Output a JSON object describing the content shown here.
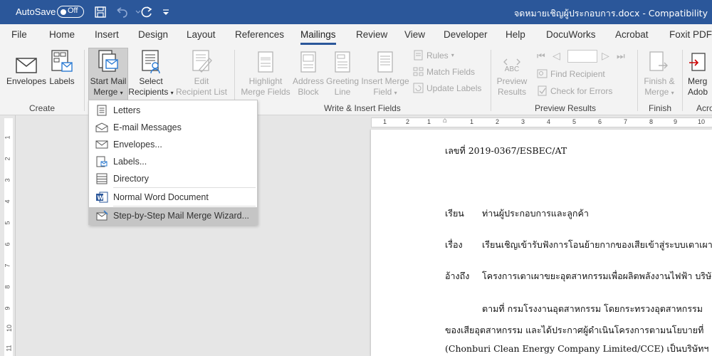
{
  "titlebar": {
    "autosave_label": "AutoSave",
    "autosave_state": "Off",
    "doc_title": "จดหมายเชิญผู้ประกอบการ.docx  -  Compatibility"
  },
  "tabs": [
    "File",
    "Home",
    "Insert",
    "Design",
    "Layout",
    "References",
    "Mailings",
    "Review",
    "View",
    "Developer",
    "Help",
    "DocuWorks",
    "Acrobat",
    "Foxit PDF"
  ],
  "active_tab": "Mailings",
  "ribbon": {
    "create": {
      "label": "Create",
      "envelopes": "Envelopes",
      "labels": "Labels"
    },
    "start": {
      "start_mail_merge_1": "Start Mail",
      "start_mail_merge_2": "Merge",
      "select_recipients_1": "Select",
      "select_recipients_2": "Recipients",
      "edit_list_1": "Edit",
      "edit_list_2": "Recipient List"
    },
    "write": {
      "label": "Write & Insert Fields",
      "highlight_1": "Highlight",
      "highlight_2": "Merge Fields",
      "address_1": "Address",
      "address_2": "Block",
      "greeting_1": "Greeting",
      "greeting_2": "Line",
      "insert_field_1": "Insert Merge",
      "insert_field_2": "Field",
      "rules": "Rules",
      "match_fields": "Match Fields",
      "update_labels": "Update Labels"
    },
    "preview": {
      "label": "Preview Results",
      "abc": "ABC",
      "preview_1": "Preview",
      "preview_2": "Results",
      "find_recipient": "Find Recipient",
      "check_errors": "Check for Errors"
    },
    "finish": {
      "label": "Finish",
      "finish_1": "Finish &",
      "finish_2": "Merge"
    },
    "acrobat": {
      "label": "Acro",
      "merge_1": "Merg",
      "merge_2": "Adob"
    }
  },
  "dropdown": [
    {
      "label": "Letters",
      "icon": "letter-icon"
    },
    {
      "label": "E-mail Messages",
      "icon": "email-icon"
    },
    {
      "label": "Envelopes...",
      "icon": "envelope-icon"
    },
    {
      "label": "Labels...",
      "icon": "labels-icon"
    },
    {
      "label": "Directory",
      "icon": "directory-icon"
    },
    {
      "label": "Normal Word Document",
      "icon": "word-icon"
    },
    {
      "label": "Step-by-Step Mail Merge Wizard...",
      "icon": "wizard-icon"
    }
  ],
  "vruler_numbers": [
    "1",
    "2",
    "3",
    "4",
    "5",
    "6",
    "7",
    "8",
    "9",
    "10",
    "11"
  ],
  "hruler_numbers": [
    "1",
    "2",
    "1",
    "1",
    "2",
    "3",
    "4",
    "5",
    "6",
    "7",
    "8",
    "9",
    "10"
  ],
  "document": {
    "ref": "เลขที่ 2019-0367/ESBEC/AT",
    "to_label": "เรียน",
    "to_text": "ท่านผู้ประกอบการและลูกค้า",
    "subject_label": "เรื่อง",
    "subject_text": "เรียนเชิญเข้ารับฟังการโอนย้ายกากของเสียเข้าสู่ระบบเตาเผาข",
    "ref2_label": "อ้างถึง",
    "ref2_text": "โครงการเตาเผาขยะอุตสาหกรรมเพื่อผลิตพลังงานไฟฟ้า บริษั",
    "p1": "ตามที่  กรมโรงงานอุตสาหกรรม  โดยกระทรวงอุตสาหกรรม",
    "p2": "ของเสียอุตสาหกรรม  และได้ประกาศผู้ดำเนินโครงการตามนโยบายที่",
    "p3": "(Chonburi Clean Energy Company Limited/CCE)   เป็นบริษัทฯ  ผู้"
  }
}
